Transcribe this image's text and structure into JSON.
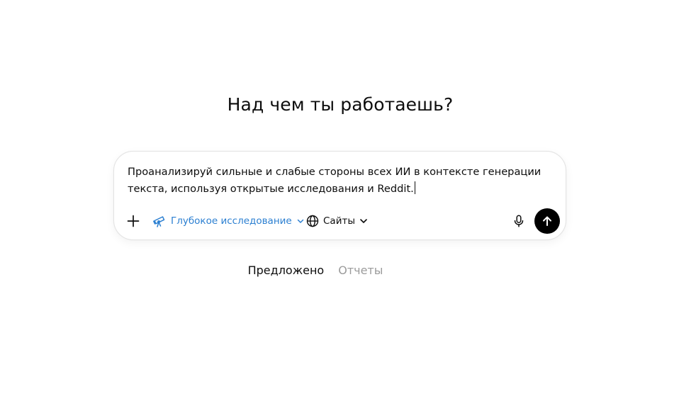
{
  "heading": "Над чем ты работаешь?",
  "composer": {
    "prompt_line1": "Проанализируй сильные и слабые стороны всех ИИ в контексте генерации",
    "prompt_line2": "текста, используя открытые исследования и Reddit.",
    "deep_research_label": "Глубокое исследование",
    "sites_label": "Сайты",
    "icons": {
      "plus": "plus-icon",
      "deep_research": "telescope-icon",
      "sites": "globe-icon",
      "mic": "microphone-icon",
      "send": "arrow-up-icon"
    },
    "colors": {
      "accent": "#2b7fd1",
      "send_bg": "#000000"
    }
  },
  "tabs": [
    {
      "label": "Предложено",
      "active": true
    },
    {
      "label": "Отчеты",
      "active": false
    }
  ]
}
